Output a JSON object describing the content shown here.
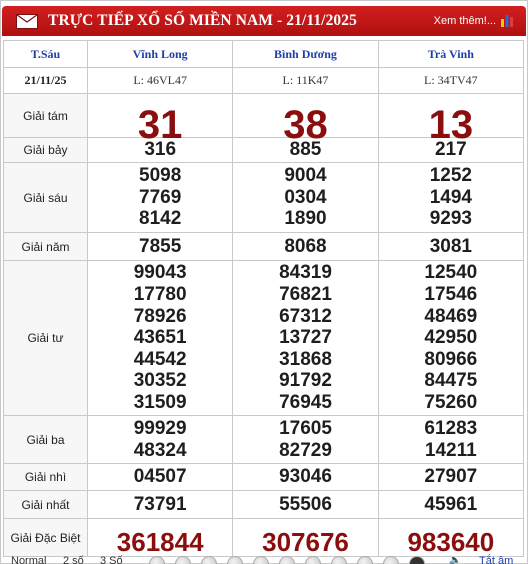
{
  "header": {
    "title": "TRỰC TIẾP XỔ SỐ MIỀN NAM - 21/11/2025",
    "see_more": "Xem thêm!..."
  },
  "table": {
    "day": "T.Sáu",
    "date": "21/11/25",
    "provinces": [
      {
        "name": "Vĩnh Long",
        "code": "L: 46VL47"
      },
      {
        "name": "Bình Dương",
        "code": "L: 11K47"
      },
      {
        "name": "Trà Vinh",
        "code": "L: 34TV47"
      }
    ],
    "prizes": [
      {
        "label": "Giải tám",
        "style": "big",
        "values": [
          [
            "31"
          ],
          [
            "38"
          ],
          [
            "13"
          ]
        ]
      },
      {
        "label": "Giải bảy",
        "style": "num",
        "values": [
          [
            "316"
          ],
          [
            "885"
          ],
          [
            "217"
          ]
        ]
      },
      {
        "label": "Giải sáu",
        "style": "num",
        "values": [
          [
            "5098",
            "7769",
            "8142"
          ],
          [
            "9004",
            "0304",
            "1890"
          ],
          [
            "1252",
            "1494",
            "9293"
          ]
        ]
      },
      {
        "label": "Giải năm",
        "style": "num",
        "values": [
          [
            "7855"
          ],
          [
            "8068"
          ],
          [
            "3081"
          ]
        ]
      },
      {
        "label": "Giải tư",
        "style": "num",
        "values": [
          [
            "99043",
            "17780",
            "78926",
            "43651",
            "44542",
            "30352",
            "31509"
          ],
          [
            "84319",
            "76821",
            "67312",
            "13727",
            "31868",
            "91792",
            "76945"
          ],
          [
            "12540",
            "17546",
            "48469",
            "42950",
            "80966",
            "84475",
            "75260"
          ]
        ]
      },
      {
        "label": "Giải ba",
        "style": "num",
        "values": [
          [
            "99929",
            "48324"
          ],
          [
            "17605",
            "82729"
          ],
          [
            "61283",
            "14211"
          ]
        ]
      },
      {
        "label": "Giải nhì",
        "style": "num",
        "values": [
          [
            "04507"
          ],
          [
            "93046"
          ],
          [
            "27907"
          ]
        ]
      },
      {
        "label": "Giải nhất",
        "style": "num",
        "values": [
          [
            "73791"
          ],
          [
            "55506"
          ],
          [
            "45961"
          ]
        ]
      },
      {
        "label": "Giải Đặc Biệt",
        "style": "db",
        "values": [
          [
            "361844"
          ],
          [
            "307676"
          ],
          [
            "983640"
          ]
        ]
      }
    ]
  },
  "footer": {
    "normal": "Normal",
    "two_digits": "2 số",
    "three_digits": "3 Số",
    "fullscreen": "Tắt âm"
  },
  "colors": {
    "header_red": "#c41a1a",
    "province_blue": "#1e3fa8",
    "prize_red": "#8b0e0e"
  }
}
